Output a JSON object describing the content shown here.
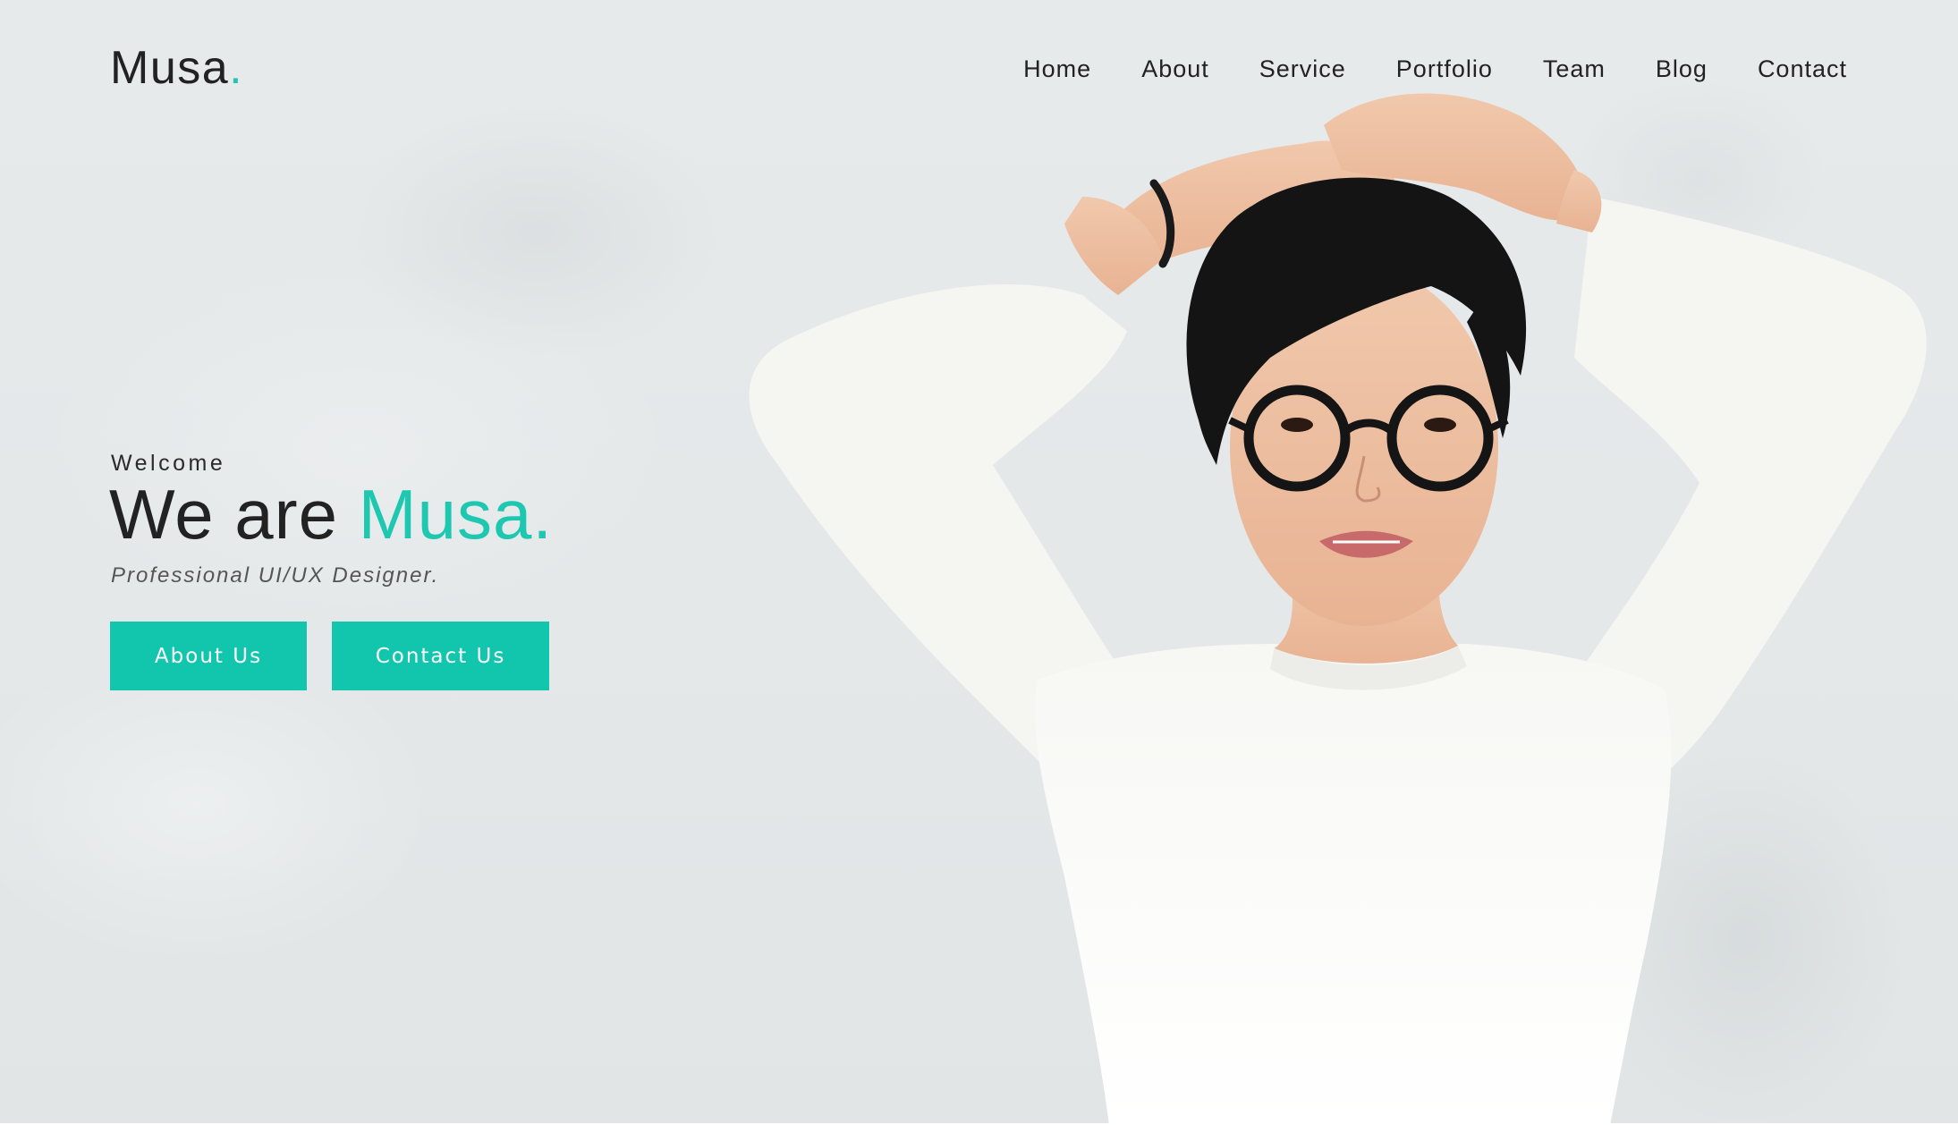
{
  "header": {
    "logo_text": "Musa",
    "logo_dot": ".",
    "nav": [
      "Home",
      "About",
      "Service",
      "Portfolio",
      "Team",
      "Blog",
      "Contact"
    ]
  },
  "hero": {
    "kicker": "Welcome",
    "headline_prefix": "We are ",
    "headline_accent": "Musa.",
    "subtitle": "Professional UI/UX Designer.",
    "buttons": {
      "about": "About Us",
      "contact": "Contact Us"
    }
  },
  "colors": {
    "accent": "#1ec8b0",
    "button": "#12c5ad",
    "text": "#222222",
    "background": "#e6e9ea"
  },
  "images": {
    "hero_photo": "woman-in-white-sweater-with-glasses"
  }
}
